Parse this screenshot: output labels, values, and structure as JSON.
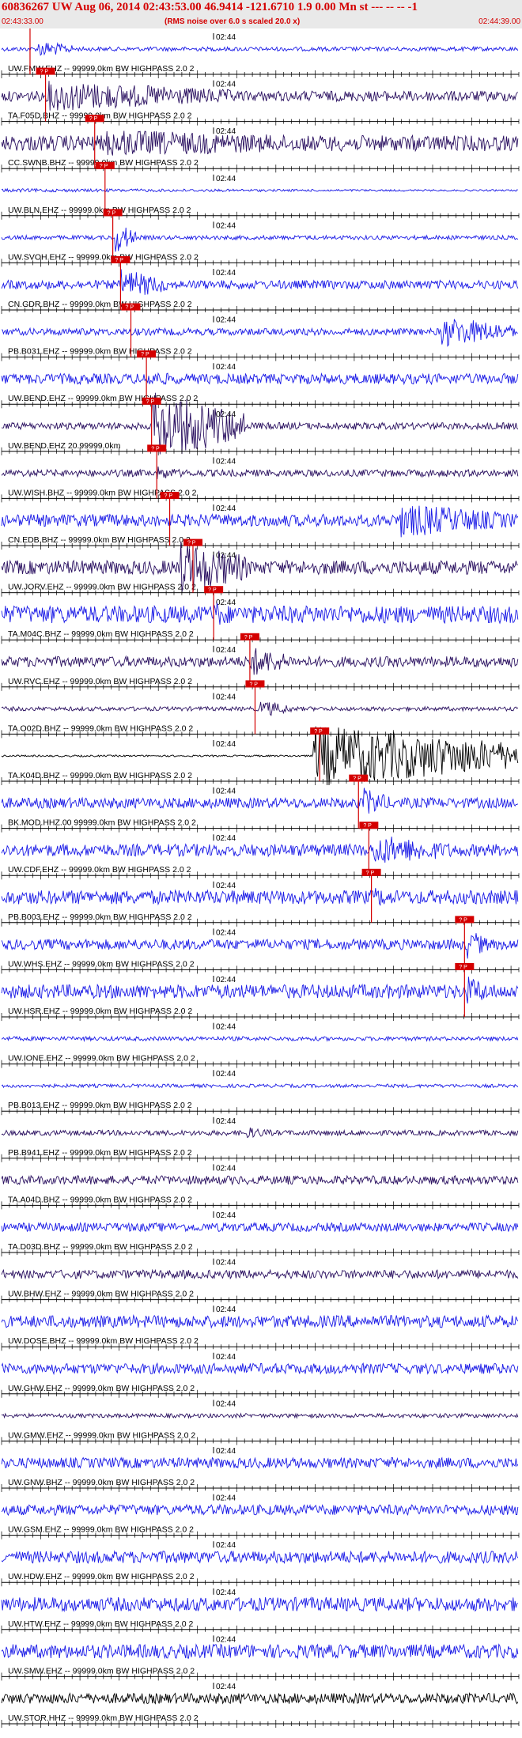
{
  "header": {
    "title": "60836267 UW Aug 06, 2014 02:43:53.00   46.9414 -121.6710  1.9 0.00 Mn st --- -- --  -1",
    "start_time": "02:43:33.00",
    "note": "(RMS noise over 6.0 s scaled 20.0 x)",
    "end_time": "02:44:39.00"
  },
  "chart_data": {
    "type": "line",
    "x_unit": "time",
    "time_range": [
      "02:43:33.00",
      "02:44:39.00"
    ],
    "minute_label": "02:44",
    "pick_label": "? P",
    "traces": [
      {
        "label": "UW.FMW.EHZ -- 99999.0km BW  HIGHPASS  2.0  2",
        "color": "#1a1ae6",
        "pick": 0.055,
        "amp": 0.12,
        "burst": [
          0.07,
          0.14
        ],
        "burst_amp": 0.5
      },
      {
        "label": "TA.F05D.BHZ -- 99999.0km BW  HIGHPASS  2.0  2",
        "color": "#2a1060",
        "pick": 0.085,
        "amp": 0.3,
        "burst": [
          0.09,
          0.45
        ],
        "burst_amp": 0.9
      },
      {
        "label": "CC.SWNB.BHZ -- 99999.0km BW  HIGHPASS  2.0  2",
        "color": "#2a1060",
        "pick": 0.18,
        "amp": 0.45,
        "burst": [
          0.2,
          0.7
        ],
        "burst_amp": 0.8
      },
      {
        "label": "UW.BLN.EHZ -- 99999.0km BW  HIGHPASS  2.0  2",
        "color": "#1a1ae6",
        "pick": 0.2,
        "amp": 0.05,
        "burst": [
          0.0,
          1.0
        ],
        "burst_amp": 0.1
      },
      {
        "label": "UW.SVOH.EHZ -- 99999.0km BW  HIGHPASS  2.0  2",
        "color": "#1a1ae6",
        "pick": 0.215,
        "amp": 0.12,
        "burst": [
          0.22,
          0.26
        ],
        "burst_amp": 0.9
      },
      {
        "label": "CN.GDR.BHZ -- 99999.0km BW  HIGHPASS  2.0  2",
        "color": "#1a1ae6",
        "pick": 0.23,
        "amp": 0.25,
        "burst": [
          0.23,
          0.32
        ],
        "burst_amp": 0.9
      },
      {
        "label": "PB.B031.EHZ -- 99999.0km BW  HIGHPASS  2.0  2",
        "color": "#1a1ae6",
        "pick": 0.25,
        "amp": 0.2,
        "burst": [
          0.85,
          0.99
        ],
        "burst_amp": 0.9
      },
      {
        "label": "UW.BEND.EHZ -- 99999.0km BW  HIGHPASS  2.0  2",
        "color": "#1a1ae6",
        "pick": 0.28,
        "amp": 0.3,
        "burst": [
          0.28,
          0.35
        ],
        "burst_amp": 0.5
      },
      {
        "label": "UW.BEND.EHZ 20.99999.0km",
        "color": "#2a1060",
        "pick": 0.29,
        "amp": 0.2,
        "burst": [
          0.29,
          0.47
        ],
        "burst_amp": 2.0
      },
      {
        "label": "UW.WISH.BHZ -- 99999.0km BW  HIGHPASS  2.0  2",
        "color": "#2a1060",
        "pick": 0.3,
        "amp": 0.2,
        "burst": [
          0.3,
          0.36
        ],
        "burst_amp": 0.4
      },
      {
        "label": "CN.EDB.BHZ -- 99999.0km BW  HIGHPASS  2.0  2",
        "color": "#1a1ae6",
        "pick": 0.325,
        "amp": 0.35,
        "burst": [
          0.77,
          0.99
        ],
        "burst_amp": 1.0
      },
      {
        "label": "UW.JORV.EHZ -- 99999.0km BW  HIGHPASS  2.0  2",
        "color": "#2a1060",
        "pick": 0.37,
        "amp": 0.4,
        "burst": [
          0.34,
          0.48
        ],
        "burst_amp": 1.6
      },
      {
        "label": "TA.M04C.BHZ -- 99999.0km BW  HIGHPASS  2.0  2",
        "color": "#1a1ae6",
        "pick": 0.41,
        "amp": 0.5,
        "burst": [
          0.41,
          0.46
        ],
        "burst_amp": 0.8
      },
      {
        "label": "UW.RVC.EHZ -- 99999.0km BW  HIGHPASS  2.0  2",
        "color": "#2a1060",
        "pick": 0.48,
        "amp": 0.3,
        "burst": [
          0.48,
          0.56
        ],
        "burst_amp": 0.9
      },
      {
        "label": "TA.O02D.BHZ -- 99999.0km BW  HIGHPASS  2.0  2",
        "color": "#2a1060",
        "pick": 0.49,
        "amp": 0.12,
        "burst": [
          0.5,
          0.56
        ],
        "burst_amp": 0.5
      },
      {
        "label": "TA.K04D.BHZ -- 99999.0km BW  HIGHPASS  2.0  2",
        "color": "#000000",
        "pick": 0.615,
        "amp": 0.05,
        "burst": [
          0.6,
          1.0
        ],
        "burst_amp": 1.8
      },
      {
        "label": "BK.MOD.HHZ.00 99999.0km BW  HIGHPASS  2.0  2",
        "color": "#1a1ae6",
        "pick": 0.69,
        "amp": 0.3,
        "burst": [
          0.7,
          0.75
        ],
        "burst_amp": 0.9
      },
      {
        "label": "UW.CDF.EHZ -- 99999.0km BW  HIGHPASS  2.0  2",
        "color": "#1a1ae6",
        "pick": 0.71,
        "amp": 0.35,
        "burst": [
          0.72,
          0.88
        ],
        "burst_amp": 0.9
      },
      {
        "label": "PB.B003.EHZ -- 99999.0km BW  HIGHPASS  2.0  2",
        "color": "#1a1ae6",
        "pick": 0.715,
        "amp": 0.4,
        "burst": [
          0.72,
          0.78
        ],
        "burst_amp": 0.6
      },
      {
        "label": "UW.WHS.EHZ -- 99999.0km BW  HIGHPASS  2.0  2",
        "color": "#1a1ae6",
        "pick": 0.895,
        "amp": 0.3,
        "burst": [
          0.9,
          0.94
        ],
        "burst_amp": 0.9
      },
      {
        "label": "UW.HSR.EHZ -- 99999.0km BW  HIGHPASS  2.0  2",
        "color": "#1a1ae6",
        "pick": 0.895,
        "amp": 0.4,
        "burst": [
          0.9,
          0.95
        ],
        "burst_amp": 0.9
      },
      {
        "label": "UW.IONE.EHZ -- 99999.0km BW  HIGHPASS  2.0  2",
        "color": "#1a1ae6",
        "amp": 0.12
      },
      {
        "label": "PB.B013.EHZ -- 99999.0km BW  HIGHPASS  2.0  2",
        "color": "#1a1ae6",
        "amp": 0.1
      },
      {
        "label": "PB.B941.EHZ -- 99999.0km BW  HIGHPASS  2.0  2",
        "color": "#2a1060",
        "amp": 0.15,
        "burst": [
          0.47,
          0.53
        ],
        "burst_amp": 0.35
      },
      {
        "label": "TA.A04D.BHZ -- 99999.0km BW  HIGHPASS  2.0  2",
        "color": "#2a1060",
        "amp": 0.25
      },
      {
        "label": "TA.D03D.BHZ -- 99999.0km BW  HIGHPASS  2.0  2",
        "color": "#1a1ae6",
        "amp": 0.25
      },
      {
        "label": "UW.BHW.EHZ -- 99999.0km BW  HIGHPASS  2.0  2",
        "color": "#2a1060",
        "amp": 0.25
      },
      {
        "label": "UW.DOSE.BHZ -- 99999.0km BW  HIGHPASS  2.0  2",
        "color": "#1a1ae6",
        "amp": 0.35
      },
      {
        "label": "UW.GHW.EHZ -- 99999.0km BW  HIGHPASS  2.0  2",
        "color": "#1a1ae6",
        "amp": 0.3
      },
      {
        "label": "UW.GMW.EHZ -- 99999.0km BW  HIGHPASS  2.0  2",
        "color": "#2a1060",
        "amp": 0.12
      },
      {
        "label": "UW.GNW.BHZ -- 99999.0km BW  HIGHPASS  2.0  2",
        "color": "#1a1ae6",
        "amp": 0.3
      },
      {
        "label": "UW.GSM.EHZ -- 99999.0km BW  HIGHPASS  2.0  2",
        "color": "#1a1ae6",
        "amp": 0.3
      },
      {
        "label": "UW.HDW.EHZ -- 99999.0km BW  HIGHPASS  2.0  2",
        "color": "#1a1ae6",
        "amp": 0.35
      },
      {
        "label": "UW.HTW.EHZ -- 99999.0km BW  HIGHPASS  2.0  2",
        "color": "#1a1ae6",
        "amp": 0.4
      },
      {
        "label": "UW.SMW.EHZ -- 99999.0km BW  HIGHPASS  2.0  2",
        "color": "#1a1ae6",
        "amp": 0.4
      },
      {
        "label": "UW.STOR.HHZ -- 99999.0km BW  HIGHPASS  2.0  2",
        "color": "#000000",
        "amp": 0.3
      }
    ]
  }
}
